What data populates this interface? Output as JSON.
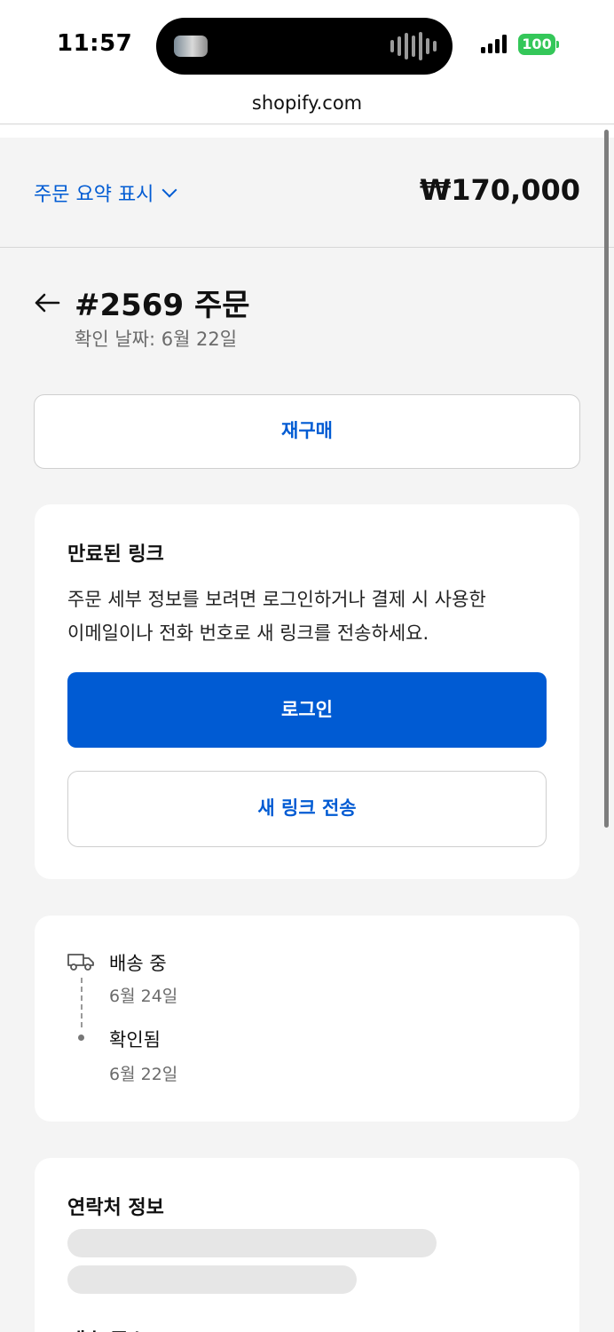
{
  "status_bar": {
    "time": "11:57",
    "battery": "100"
  },
  "browser": {
    "url": "shopify.com"
  },
  "summary": {
    "toggle_label": "주문 요약 표시",
    "total": "₩170,000"
  },
  "order": {
    "title": "#2569 주문",
    "confirmed_date": "확인 날짜: 6월 22일"
  },
  "reorder_button": "재구매",
  "expired_card": {
    "title": "만료된 링크",
    "body_line1": "주문 세부 정보를 보려면 로그인하거나 결제 시 사용한",
    "body_line2": "이메일이나 전화 번호로 새 링크를 전송하세요.",
    "login_button": "로그인",
    "new_link_button": "새 링크 전송"
  },
  "timeline": [
    {
      "status": "배송 중",
      "date": "6월 24일"
    },
    {
      "status": "확인됨",
      "date": "6월 22일"
    }
  ],
  "contact_card": {
    "title": "연락처 정보",
    "next_heading": "배송 주소"
  },
  "colors": {
    "accent": "#005bd3",
    "background": "#f4f4f4",
    "battery": "#34c759"
  }
}
